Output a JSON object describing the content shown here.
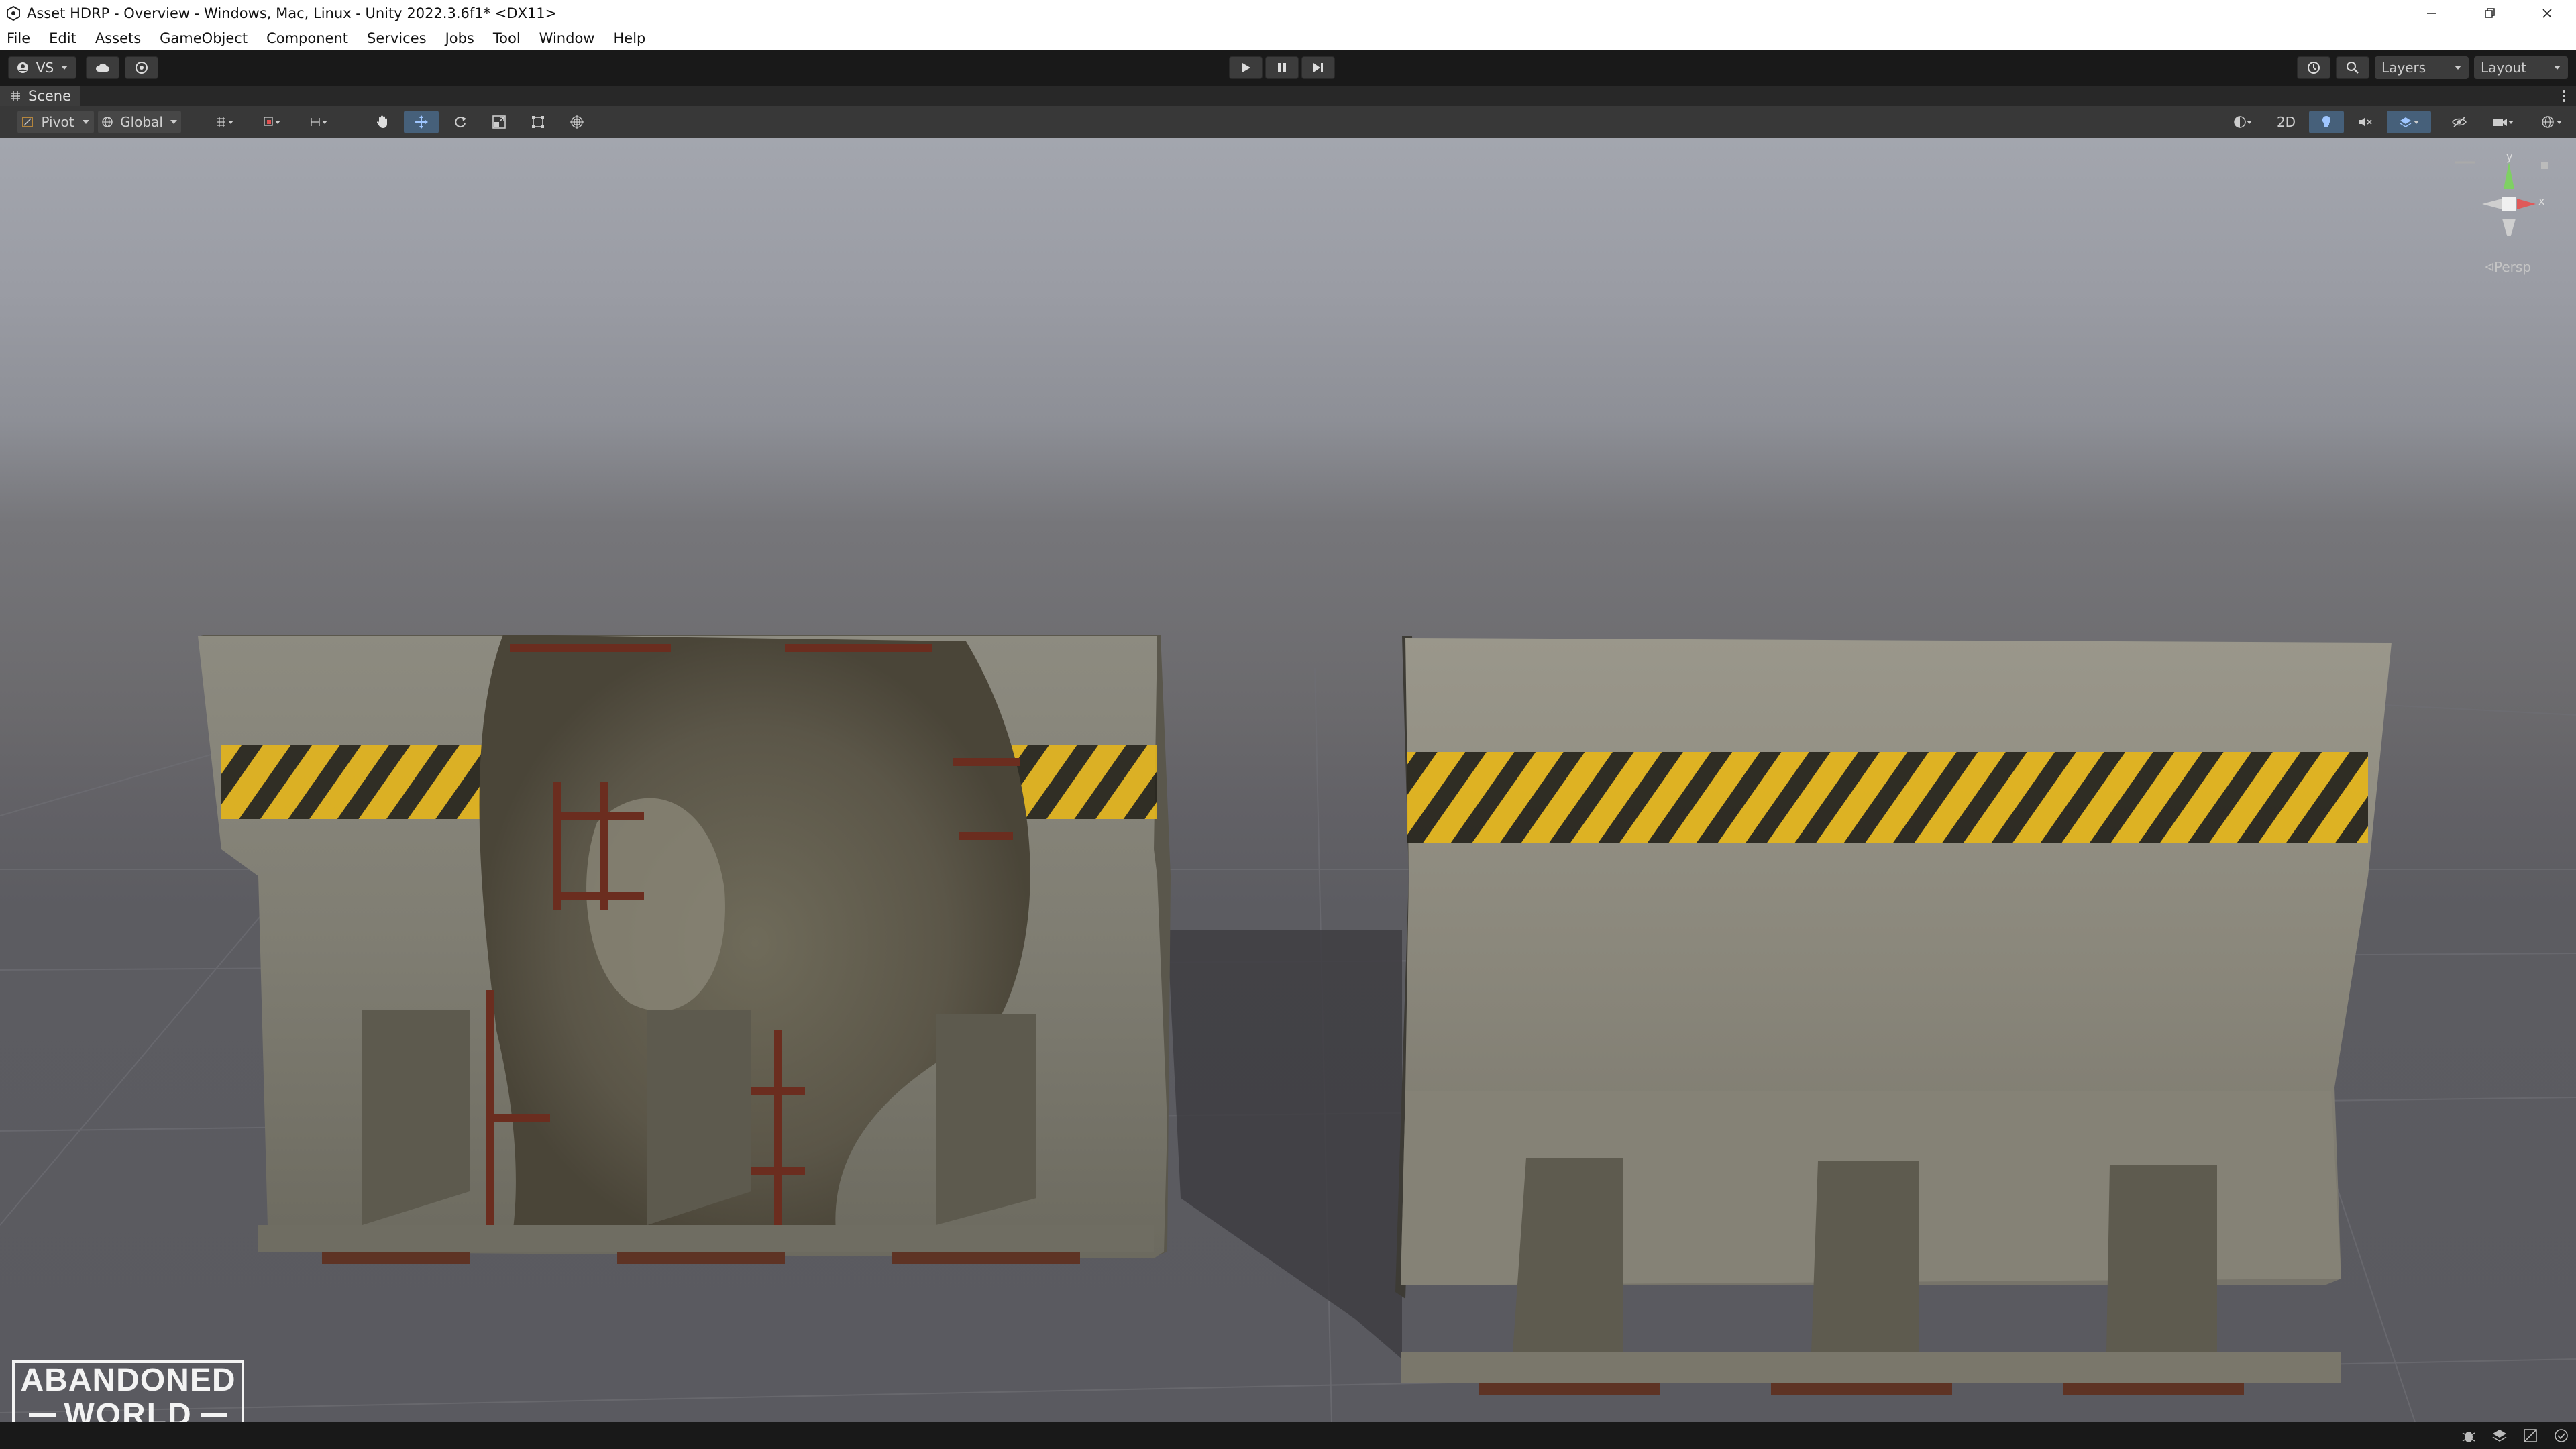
{
  "window": {
    "title": "Asset HDRP - Overview - Windows, Mac, Linux - Unity 2022.3.6f1* <DX11>"
  },
  "menu": {
    "items": [
      "File",
      "Edit",
      "Assets",
      "GameObject",
      "Component",
      "Services",
      "Jobs",
      "Tool",
      "Window",
      "Help"
    ]
  },
  "toolbar": {
    "account_label": "VS",
    "layers_label": "Layers",
    "layout_label": "Layout"
  },
  "scene_tab": {
    "label": "Scene"
  },
  "scene_toolbar": {
    "pivot_label": "Pivot",
    "global_label": "Global",
    "mode_2d_label": "2D"
  },
  "gizmo": {
    "y_label": "y",
    "x_label": "x",
    "projection_label": "Persp"
  },
  "watermark": {
    "line1": "ABANDONED",
    "line2": "WORLD"
  },
  "colors": {
    "hazard_yellow": "#e4b51b",
    "concrete": "#8c8a7e",
    "rust": "#6b2d1f",
    "play_mode_tint": "#4d88ff"
  }
}
